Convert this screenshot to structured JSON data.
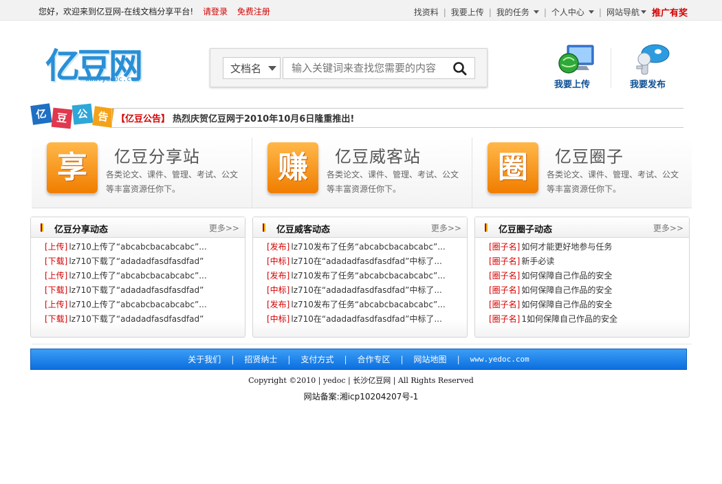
{
  "topbar": {
    "welcome": "您好，欢迎来到亿豆网-在线文档分享平台!",
    "login": "请登录",
    "register": "免费注册",
    "nav": [
      "找资料",
      "我要上传",
      "我的任务",
      "个人中心",
      "网站导航"
    ],
    "promo": "推广有奖"
  },
  "logo": {
    "brand": "亿豆网",
    "url": "www.yedoc.com"
  },
  "search": {
    "type_label": "文档名",
    "placeholder": "输入关键词来查找您需要的内容"
  },
  "quick": {
    "upload": "我要上传",
    "publish": "我要发布"
  },
  "notice": {
    "badge": [
      "亿",
      "豆",
      "公",
      "告"
    ],
    "tag": "【亿豆公告】",
    "text": "热烈庆贺亿豆网于2010年10月6日隆重推出!"
  },
  "features": [
    {
      "icon_char": "享",
      "title": "亿豆分享站",
      "desc": "各类论文、课件、管理、考试、公文等丰富资源任你下。"
    },
    {
      "icon_char": "赚",
      "title": "亿豆威客站",
      "desc": "各类论文、课件、管理、考试、公文等丰富资源任你下。"
    },
    {
      "icon_char": "圈",
      "title": "亿豆圈子",
      "desc": "各类论文、课件、管理、考试、公文等丰富资源任你下。"
    }
  ],
  "panels": [
    {
      "title": "亿豆分享动态",
      "more": "更多>>",
      "items": [
        {
          "tag": "[上传]",
          "text": "lz710上传了“abcabcbacabcabc”..."
        },
        {
          "tag": "[下载]",
          "text": "lz710下载了“adadadfasdfasdfad”"
        },
        {
          "tag": "[上传]",
          "text": "lz710上传了“abcabcbacabcabc”..."
        },
        {
          "tag": "[下载]",
          "text": "lz710下载了“adadadfasdfasdfad”"
        },
        {
          "tag": "[上传]",
          "text": "lz710上传了“abcabcbacabcabc”..."
        },
        {
          "tag": "[下载]",
          "text": "lz710下载了“adadadfasdfasdfad”"
        }
      ]
    },
    {
      "title": "亿豆威客动态",
      "more": "更多>>",
      "items": [
        {
          "tag": "[发布]",
          "text": "lz710发布了任务“abcabcbacabcabc”..."
        },
        {
          "tag": "[中标]",
          "text": "lz710在“adadadfasdfasdfad”中标了..."
        },
        {
          "tag": "[发布]",
          "text": "lz710发布了任务“abcabcbacabcabc”..."
        },
        {
          "tag": "[中标]",
          "text": "lz710在“adadadfasdfasdfad”中标了..."
        },
        {
          "tag": "[发布]",
          "text": "lz710发布了任务“abcabcbacabcabc”..."
        },
        {
          "tag": "[中标]",
          "text": "lz710在“adadadfasdfasdfad”中标了..."
        }
      ]
    },
    {
      "title": "亿豆圈子动态",
      "more": "更多>>",
      "items": [
        {
          "tag": "[圈子名]",
          "text": "如何才能更好地参与任务"
        },
        {
          "tag": "[圈子名]",
          "text": "新手必读"
        },
        {
          "tag": "[圈子名]",
          "text": "如何保障自己作品的安全"
        },
        {
          "tag": "[圈子名]",
          "text": "如何保障自己作品的安全"
        },
        {
          "tag": "[圈子名]",
          "text": "如何保障自己作品的安全"
        },
        {
          "tag": "[圈子名]",
          "text": "1如何保障自己作品的安全"
        }
      ]
    }
  ],
  "footer": {
    "links": [
      "关于我们",
      "招贤纳士",
      "支付方式",
      "合作专区",
      "网站地图"
    ],
    "site": "www.yedoc.com",
    "copyright": "Copyright ©2010 | yedoc | 长沙亿豆网 | All Rights Reserved",
    "icp": "网站备案:湘icp10204207号-1"
  },
  "colors": {
    "accent_red": "#d40000",
    "brand_blue": "#2a8fd6",
    "footer_blue": "#0b6fe0",
    "feature_orange": "#f07d00"
  }
}
